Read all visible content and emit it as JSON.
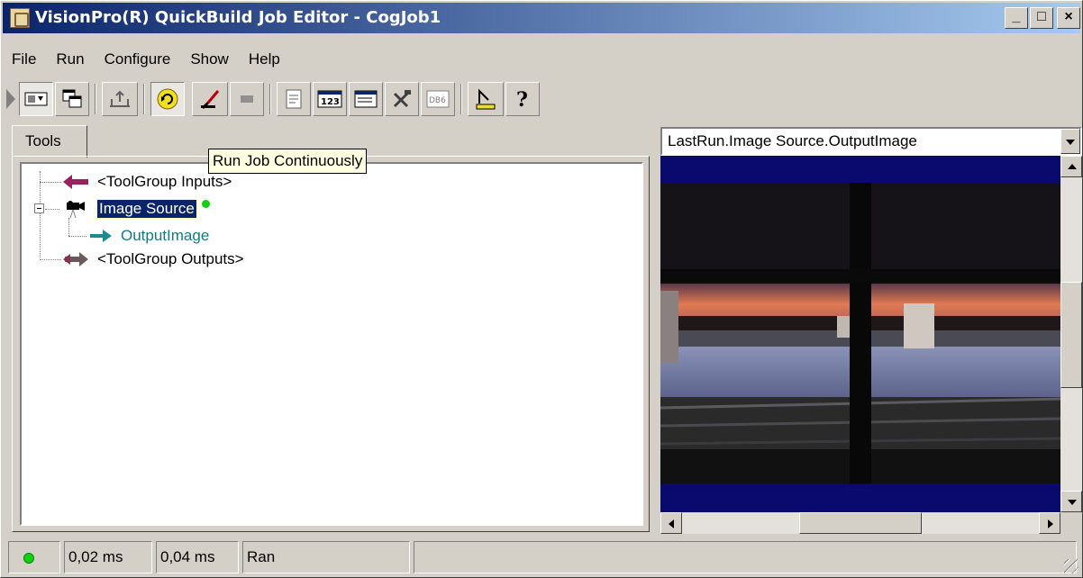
{
  "window": {
    "title": "VisionPro(R) QuickBuild Job Editor - CogJob1",
    "controls": {
      "minimize": "_",
      "maximize": "□",
      "close": "×"
    }
  },
  "menu": [
    "File",
    "Run",
    "Configure",
    "Show",
    "Help"
  ],
  "toolbar": {
    "buttons": [
      "run-once-icon",
      "toggle-view-icon",
      "windows-icon",
      "import-icon",
      "run-continuous-icon",
      "edit-icon",
      "stop-icon",
      "properties-icon",
      "numeric-icon",
      "form-icon",
      "tools-icon",
      "database-icon",
      "measure-icon",
      "help-icon"
    ],
    "tooltip": "Run Job Continuously"
  },
  "tools_panel": {
    "tab": "Tools",
    "tree": [
      {
        "label": "<ToolGroup Inputs>",
        "icon": "input-arrow-icon"
      },
      {
        "label": "Image Source",
        "icon": "camera-icon",
        "selected": true,
        "status": "green"
      },
      {
        "label": "OutputImage",
        "icon": "output-arrow-icon"
      },
      {
        "label": "<ToolGroup Outputs>",
        "icon": "output-group-arrow-icon"
      }
    ]
  },
  "image_panel": {
    "selector": "LastRun.Image Source.OutputImage"
  },
  "statusbar": {
    "led": "green",
    "time1": "0,02 ms",
    "time2": "0,04 ms",
    "status": "Ran"
  },
  "colors": {
    "title_start": "#0a246a",
    "title_end": "#a6caf0",
    "selection": "#0a246a",
    "image_band": "#0a0a6e",
    "output_link": "#0e7c86",
    "status_ok": "#10d010"
  }
}
